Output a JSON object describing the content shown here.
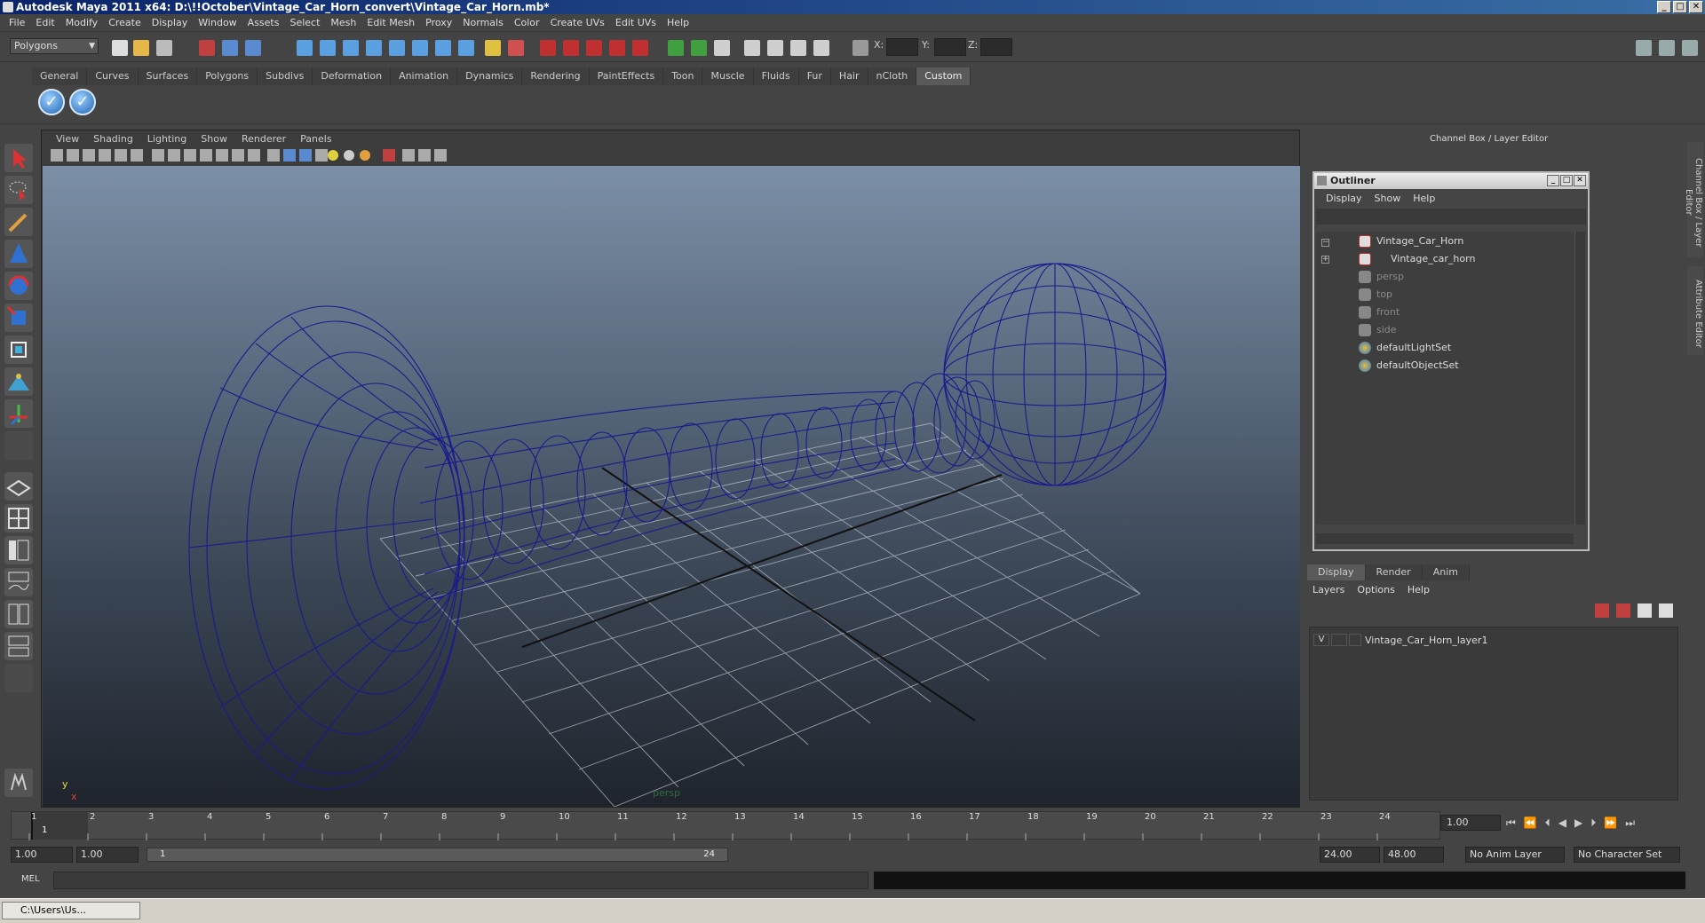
{
  "window": {
    "title": "Autodesk Maya 2011 x64: D:\\!!October\\Vintage_Car_Horn_convert\\Vintage_Car_Horn.mb*",
    "minimize": "_",
    "maximize": "□",
    "close": "✕"
  },
  "menubar": [
    "File",
    "Edit",
    "Modify",
    "Create",
    "Display",
    "Window",
    "Assets",
    "Select",
    "Mesh",
    "Edit Mesh",
    "Proxy",
    "Normals",
    "Color",
    "Create UVs",
    "Edit UVs",
    "Help"
  ],
  "statusline": {
    "mode": "Polygons",
    "x_label": "X:",
    "y_label": "Y:",
    "z_label": "Z:"
  },
  "shelf": {
    "tabs": [
      "General",
      "Curves",
      "Surfaces",
      "Polygons",
      "Subdivs",
      "Deformation",
      "Animation",
      "Dynamics",
      "Rendering",
      "PaintEffects",
      "Toon",
      "Muscle",
      "Fluids",
      "Fur",
      "Hair",
      "nCloth",
      "Custom"
    ],
    "active_tab": "Custom"
  },
  "viewport": {
    "menu": [
      "View",
      "Shading",
      "Lighting",
      "Show",
      "Renderer",
      "Panels"
    ],
    "camera_label": "persp",
    "axis_y": "y",
    "axis_x": "x"
  },
  "channel_box": {
    "title": "Channel Box / Layer Editor"
  },
  "outliner": {
    "title": "Outliner",
    "menu": [
      "Display",
      "Show",
      "Help"
    ],
    "items": [
      {
        "label": "Vintage_Car_Horn",
        "dim": false
      },
      {
        "label": "Vintage_car_horn",
        "dim": false
      },
      {
        "label": "persp",
        "dim": true
      },
      {
        "label": "top",
        "dim": true
      },
      {
        "label": "front",
        "dim": true
      },
      {
        "label": "side",
        "dim": true
      },
      {
        "label": "defaultLightSet",
        "dim": false
      },
      {
        "label": "defaultObjectSet",
        "dim": false
      }
    ]
  },
  "layer_editor": {
    "tabs": [
      "Display",
      "Render",
      "Anim"
    ],
    "active_tab": "Display",
    "menu": [
      "Layers",
      "Options",
      "Help"
    ],
    "layer": {
      "visible": "V",
      "name": "Vintage_Car_Horn_layer1"
    }
  },
  "side_tabs": [
    "Channel Box / Layer Editor",
    "Attribute Editor"
  ],
  "timeline": {
    "ticks": [
      "1",
      "2",
      "3",
      "4",
      "5",
      "6",
      "7",
      "8",
      "9",
      "10",
      "11",
      "12",
      "13",
      "14",
      "15",
      "16",
      "17",
      "18",
      "19",
      "20",
      "21",
      "22",
      "23",
      "24"
    ],
    "current_frame_marker": "1",
    "current_frame": "1.00",
    "play_buttons": [
      "⏮",
      "⏪",
      "⏴",
      "◀",
      "▶",
      "⏵",
      "⏩",
      "⏭"
    ]
  },
  "range": {
    "start": "1.00",
    "anim_start": "1.00",
    "slider_start": "1",
    "slider_end": "24",
    "anim_end": "24.00",
    "end": "48.00",
    "anim_layer": "No Anim Layer",
    "character_set": "No Character Set"
  },
  "mel": {
    "label": "MEL"
  },
  "taskbar": {
    "item": "C:\\Users\\Us..."
  },
  "colors": {
    "wireframe": "#1a1a8c",
    "grid": "#aab2bd",
    "accent": "#0a246a"
  }
}
